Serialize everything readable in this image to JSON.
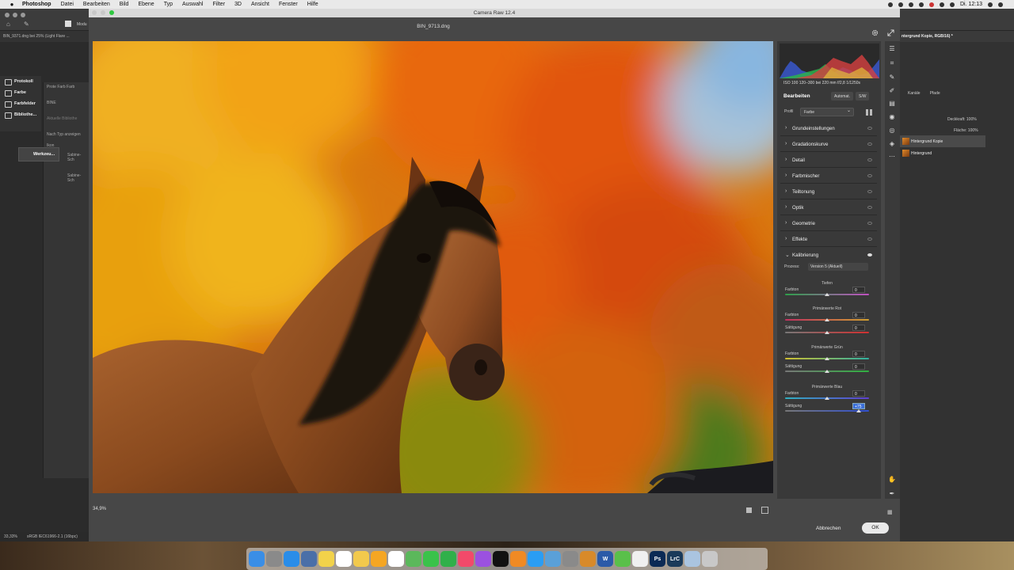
{
  "menubar": {
    "app": "Photoshop",
    "items": [
      "Datei",
      "Bearbeiten",
      "Bild",
      "Ebene",
      "Typ",
      "Auswahl",
      "Filter",
      "3D",
      "Ansicht",
      "Fenster",
      "Hilfe"
    ],
    "clock": "Di. 12:13"
  },
  "photoshop": {
    "doc_tab": "BIN_9371.dng bei 25% (Light Flare ...",
    "modus_label": "Modu",
    "brush_size": "380",
    "left_panels": [
      "Protokoll",
      "Farbe",
      "Farbfelder",
      "Bibliothe..."
    ],
    "werkzeug": "Werkzeu...",
    "panel2_tabs": "Prote  Farb  Farb",
    "library_name": "BINE",
    "library_search": "Aktuelle Bibliothe",
    "library_sort": "Nach Typ anzeigen",
    "library_group": "Ikon",
    "library_items": [
      "Sabine-Sch",
      "Sabine-Sch"
    ],
    "status_zoom": "33,33%",
    "status_profile": "sRGB IEC61966-2.1 (16bpc)",
    "right_doc_tab": "ntergrund Kopie, RGB/16) *",
    "right_tabs": [
      "Kanäle",
      "Pfade"
    ],
    "opacity_label": "Deckkraft:",
    "opacity_value": "100%",
    "fill_label": "Fläche:",
    "fill_value": "100%",
    "layers": [
      "Hintergrund Kopie",
      "Hintergrund"
    ]
  },
  "camera_raw": {
    "window_title": "Camera Raw 12.4",
    "filename": "BIN_9713.dng",
    "zoom": "34,9%",
    "camera_info": "ISO 100   120–300 bei 220 mm   f/2,8   1/1250s",
    "edit_title": "Bearbeiten",
    "auto_button": "Automat.",
    "bw_button": "S/W",
    "profile_label": "Profil",
    "profile_value": "Farbe",
    "sections": [
      "Grundeinstellungen",
      "Gradationskurve",
      "Detail",
      "Farbmischer",
      "Teiltonung",
      "Optik",
      "Geometrie",
      "Effekte",
      "Kalibrierung"
    ],
    "process_label": "Prozess:",
    "process_value": "Version 5 (Aktuell)",
    "calibration": [
      {
        "group": "Tiefen",
        "sliders": [
          {
            "label": "Farbton",
            "value": "0",
            "level": 0
          }
        ]
      },
      {
        "group": "Primärwerte Rot",
        "sliders": [
          {
            "label": "Farbton",
            "value": "0",
            "level": 0
          },
          {
            "label": "Sättigung",
            "value": "0",
            "level": 0
          }
        ]
      },
      {
        "group": "Primärwerte Grün",
        "sliders": [
          {
            "label": "Farbton",
            "value": "0",
            "level": 0
          },
          {
            "label": "Sättigung",
            "value": "0",
            "level": 0
          }
        ]
      },
      {
        "group": "Primärwerte Blau",
        "sliders": [
          {
            "label": "Farbton",
            "value": "0",
            "level": 0
          },
          {
            "label": "Sättigung",
            "value": "+75",
            "level": 75
          }
        ]
      }
    ],
    "cancel_label": "Abbrechen",
    "ok_label": "OK"
  },
  "colors": {
    "accent": "#3b6fd9",
    "panel": "#393939",
    "window": "#474747"
  },
  "dock_apps": [
    "Finder",
    "Launchpad",
    "Safari",
    "Mail",
    "Notes",
    "Calendar",
    "Notes",
    "Photos",
    "Reminders",
    "Maps",
    "Messages",
    "FaceTime",
    "Music",
    "Podcasts",
    "TV",
    "Books",
    "App Store",
    "Preview",
    "System Preferences",
    "Bridge",
    "Word",
    "Messenger",
    "Document",
    "Photoshop",
    "Lightroom Classic",
    "Downloads",
    "Trash"
  ]
}
